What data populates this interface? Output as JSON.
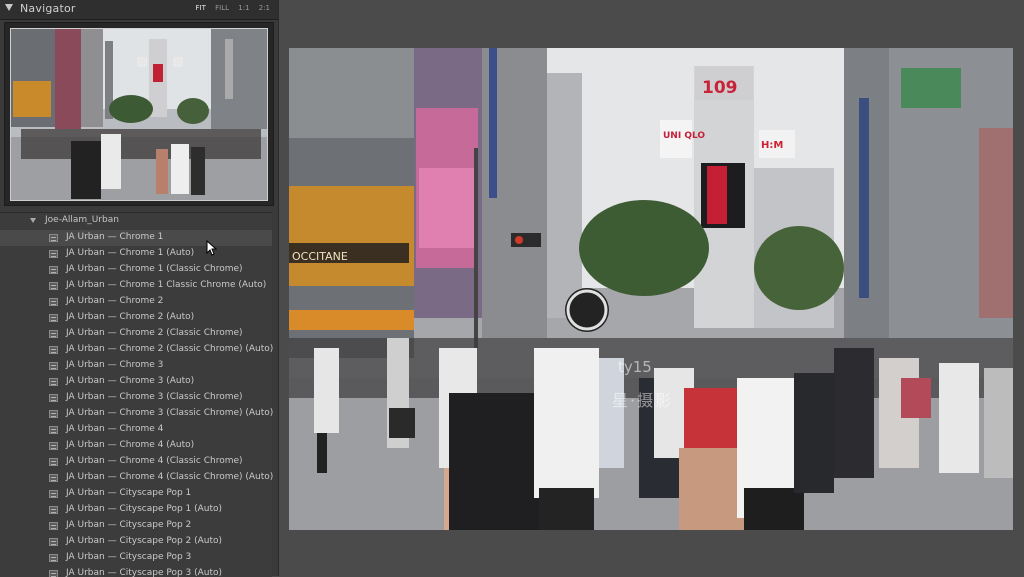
{
  "navigator": {
    "title": "Navigator",
    "zoom_options": [
      "FIT",
      "FILL",
      "1:1",
      "2:1"
    ],
    "active_zoom": "FIT"
  },
  "folder": {
    "name": "Joe-Allam_Urban"
  },
  "presets": [
    "JA Urban — Chrome 1",
    "JA Urban — Chrome 1 (Auto)",
    "JA Urban — Chrome 1 (Classic Chrome)",
    "JA Urban — Chrome 1 Classic Chrome (Auto)",
    "JA Urban — Chrome 2",
    "JA Urban — Chrome 2 (Auto)",
    "JA Urban — Chrome 2 (Classic Chrome)",
    "JA Urban — Chrome 2 (Classic Chrome) (Auto)",
    "JA Urban — Chrome 3",
    "JA Urban — Chrome 3 (Auto)",
    "JA Urban — Chrome 3 (Classic Chrome)",
    "JA Urban — Chrome 3 (Classic Chrome) (Auto)",
    "JA Urban — Chrome 4",
    "JA Urban — Chrome 4 (Auto)",
    "JA Urban — Chrome 4 (Classic Chrome)",
    "JA Urban — Chrome 4 (Classic Chrome) (Auto)",
    "JA Urban — Cityscape Pop 1",
    "JA Urban — Cityscape Pop 1 (Auto)",
    "JA Urban — Cityscape Pop 2",
    "JA Urban — Cityscape Pop 2 (Auto)",
    "JA Urban — Cityscape Pop 3",
    "JA Urban — Cityscape Pop 3 (Auto)"
  ],
  "photo": {
    "signs": [
      "109",
      "UNI QLO",
      "H:M",
      "OCCITANE"
    ]
  },
  "watermark": {
    "line1": "ty15",
    "line2": "星·摄影"
  }
}
